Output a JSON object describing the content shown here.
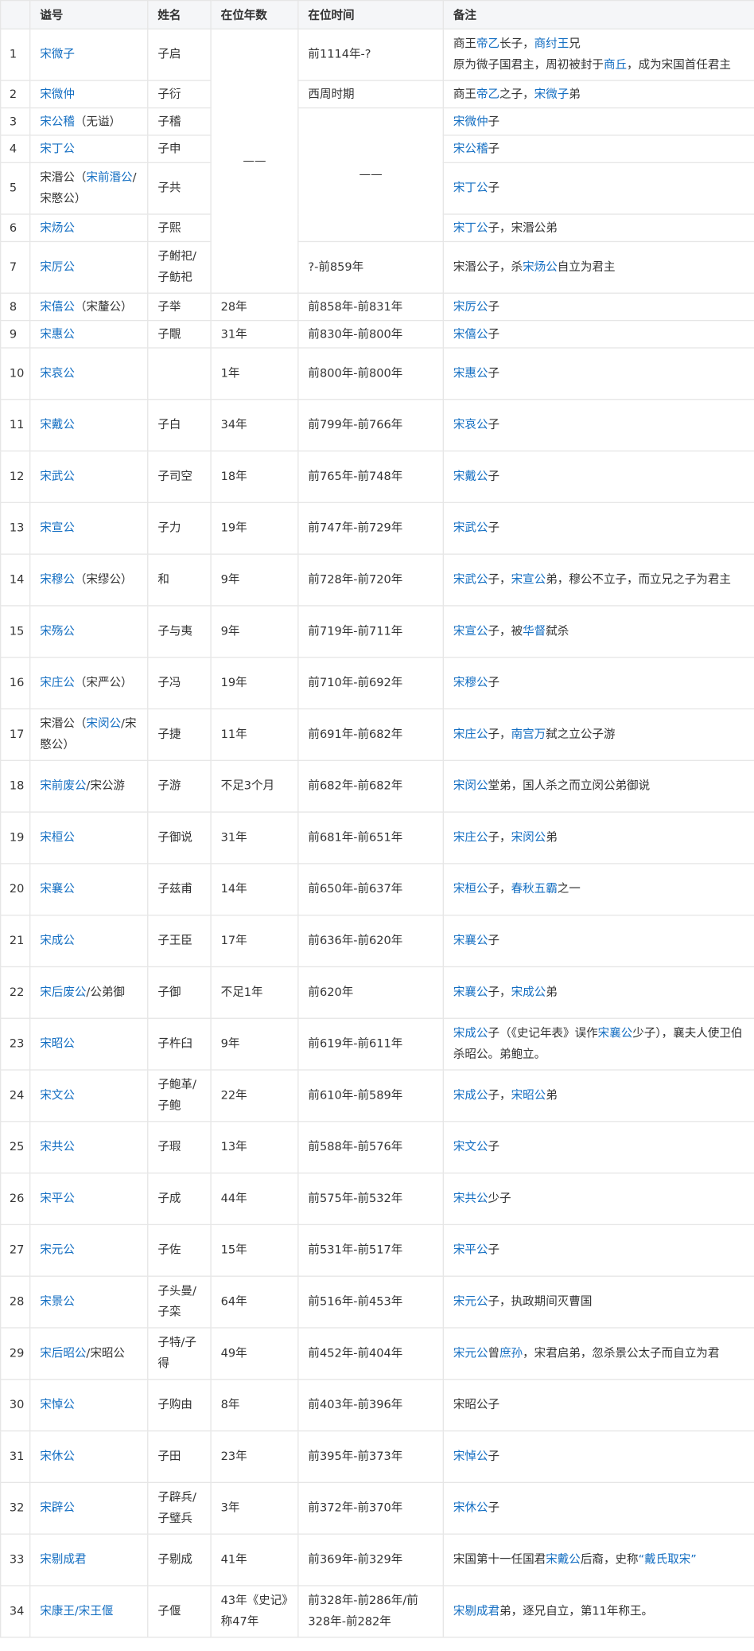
{
  "headers": {
    "index": "",
    "shi": "谥号",
    "name": "姓名",
    "years": "在位年数",
    "period": "在位时间",
    "note": "备注"
  },
  "dash": "——",
  "rows": [
    {
      "idx": "1",
      "shi": [
        {
          "t": "宋微子",
          "l": true
        }
      ],
      "name": "子启",
      "years": "",
      "period": "前1114年-?",
      "note": [
        {
          "t": "商王",
          "l": false
        },
        {
          "t": "帝乙",
          "l": true
        },
        {
          "t": "长子，",
          "l": false
        },
        {
          "t": "商纣王",
          "l": true
        },
        {
          "t": "兄",
          "l": false
        }
      ],
      "note2": [
        {
          "t": "原为微子国君主，周初被封于",
          "l": false
        },
        {
          "t": "商丘",
          "l": true
        },
        {
          "t": "，成为宋国首任君主",
          "l": false
        }
      ]
    },
    {
      "idx": "2",
      "shi": [
        {
          "t": "宋微仲",
          "l": true
        }
      ],
      "name": "子衍",
      "years": "",
      "period": "西周时期",
      "note": [
        {
          "t": "商王",
          "l": false
        },
        {
          "t": "帝乙",
          "l": true
        },
        {
          "t": "之子，",
          "l": false
        },
        {
          "t": "宋微子",
          "l": true
        },
        {
          "t": "弟",
          "l": false
        }
      ]
    },
    {
      "idx": "3",
      "shi": [
        {
          "t": "宋公稽",
          "l": true
        },
        {
          "t": "（无谥）",
          "l": false
        }
      ],
      "name": "子稽",
      "years": "",
      "period": "",
      "note": [
        {
          "t": "宋微仲",
          "l": true
        },
        {
          "t": "子",
          "l": false
        }
      ]
    },
    {
      "idx": "4",
      "shi": [
        {
          "t": "宋丁公",
          "l": true
        }
      ],
      "name": "子申",
      "years": "",
      "period": "",
      "note": [
        {
          "t": "宋公稽",
          "l": true
        },
        {
          "t": "子",
          "l": false
        }
      ]
    },
    {
      "idx": "5",
      "shi": [
        {
          "t": "宋湣公（",
          "l": false
        },
        {
          "t": "宋前湣公",
          "l": true
        },
        {
          "t": "/宋愍公）",
          "l": false
        }
      ],
      "name": "子共",
      "years": "",
      "period": "",
      "note": [
        {
          "t": "宋丁公",
          "l": true
        },
        {
          "t": "子",
          "l": false
        }
      ]
    },
    {
      "idx": "6",
      "shi": [
        {
          "t": "宋炀公",
          "l": true
        }
      ],
      "name": "子熙",
      "years": "",
      "period": "",
      "note": [
        {
          "t": "宋丁公",
          "l": true
        },
        {
          "t": "子，宋湣公弟",
          "l": false
        }
      ]
    },
    {
      "idx": "7",
      "shi": [
        {
          "t": "宋厉公",
          "l": true
        }
      ],
      "name": "子鲋祀/子鲂祀",
      "years": "",
      "period": "?-前859年",
      "note": [
        {
          "t": "宋湣公子，杀",
          "l": false
        },
        {
          "t": "宋炀公",
          "l": true
        },
        {
          "t": "自立为君主",
          "l": false
        }
      ]
    },
    {
      "idx": "8",
      "shi": [
        {
          "t": "宋僖公",
          "l": true
        },
        {
          "t": "（宋釐公）",
          "l": false
        }
      ],
      "name": "子举",
      "years": "28年",
      "period": "前858年-前831年",
      "note": [
        {
          "t": "宋厉公",
          "l": true
        },
        {
          "t": "子",
          "l": false
        }
      ]
    },
    {
      "idx": "9",
      "shi": [
        {
          "t": "宋惠公",
          "l": true
        }
      ],
      "name": "子覸",
      "years": "31年",
      "period": "前830年-前800年",
      "note": [
        {
          "t": "宋僖公",
          "l": true
        },
        {
          "t": "子",
          "l": false
        }
      ]
    },
    {
      "idx": "10",
      "shi": [
        {
          "t": "宋哀公",
          "l": true
        }
      ],
      "name": "",
      "years": "1年",
      "period": "前800年-前800年",
      "note": [
        {
          "t": "宋惠公",
          "l": true
        },
        {
          "t": "子",
          "l": false
        }
      ]
    },
    {
      "idx": "11",
      "shi": [
        {
          "t": "宋戴公",
          "l": true
        }
      ],
      "name": "子白",
      "years": "34年",
      "period": "前799年-前766年",
      "note": [
        {
          "t": "宋哀公",
          "l": true
        },
        {
          "t": "子",
          "l": false
        }
      ]
    },
    {
      "idx": "12",
      "shi": [
        {
          "t": "宋武公",
          "l": true
        }
      ],
      "name": "子司空",
      "years": "18年",
      "period": "前765年-前748年",
      "note": [
        {
          "t": "宋戴公",
          "l": true
        },
        {
          "t": "子",
          "l": false
        }
      ]
    },
    {
      "idx": "13",
      "shi": [
        {
          "t": "宋宣公",
          "l": true
        }
      ],
      "name": "子力",
      "years": "19年",
      "period": "前747年-前729年",
      "note": [
        {
          "t": "宋武公",
          "l": true
        },
        {
          "t": "子",
          "l": false
        }
      ]
    },
    {
      "idx": "14",
      "shi": [
        {
          "t": "宋穆公",
          "l": true
        },
        {
          "t": "（宋缪公）",
          "l": false
        }
      ],
      "name": "和",
      "years": "9年",
      "period": "前728年-前720年",
      "note": [
        {
          "t": "宋武公",
          "l": true
        },
        {
          "t": "子，",
          "l": false
        },
        {
          "t": "宋宣公",
          "l": true
        },
        {
          "t": "弟，穆公不立子，而立兄之子为君主",
          "l": false
        }
      ]
    },
    {
      "idx": "15",
      "shi": [
        {
          "t": "宋殇公",
          "l": true
        }
      ],
      "name": "子与夷",
      "years": "9年",
      "period": "前719年-前711年",
      "note": [
        {
          "t": "宋宣公",
          "l": true
        },
        {
          "t": "子，被",
          "l": false
        },
        {
          "t": "华督",
          "l": true
        },
        {
          "t": "弑杀",
          "l": false
        }
      ]
    },
    {
      "idx": "16",
      "shi": [
        {
          "t": "宋庄公",
          "l": true
        },
        {
          "t": "（宋严公）",
          "l": false
        }
      ],
      "name": "子冯",
      "years": "19年",
      "period": "前710年-前692年",
      "note": [
        {
          "t": "宋穆公",
          "l": true
        },
        {
          "t": "子",
          "l": false
        }
      ]
    },
    {
      "idx": "17",
      "shi": [
        {
          "t": "宋湣公（",
          "l": false
        },
        {
          "t": "宋闵公",
          "l": true
        },
        {
          "t": "/宋愍公）",
          "l": false
        }
      ],
      "name": "子捷",
      "years": "11年",
      "period": "前691年-前682年",
      "note": [
        {
          "t": "宋庄公",
          "l": true
        },
        {
          "t": "子，",
          "l": false
        },
        {
          "t": "南宫万",
          "l": true
        },
        {
          "t": "弑之立公子游",
          "l": false
        }
      ]
    },
    {
      "idx": "18",
      "shi": [
        {
          "t": "宋前废公",
          "l": true
        },
        {
          "t": "/宋公游",
          "l": false
        }
      ],
      "name": "子游",
      "years": "不足3个月",
      "period": "前682年-前682年",
      "note": [
        {
          "t": "宋闵公",
          "l": true
        },
        {
          "t": "堂弟，国人杀之而立闵公弟御说",
          "l": false
        }
      ]
    },
    {
      "idx": "19",
      "shi": [
        {
          "t": "宋桓公",
          "l": true
        }
      ],
      "name": "子御说",
      "years": "31年",
      "period": "前681年-前651年",
      "note": [
        {
          "t": "宋庄公",
          "l": true
        },
        {
          "t": "子，",
          "l": false
        },
        {
          "t": "宋闵公",
          "l": true
        },
        {
          "t": "弟",
          "l": false
        }
      ]
    },
    {
      "idx": "20",
      "shi": [
        {
          "t": "宋襄公",
          "l": true
        }
      ],
      "name": "子兹甫",
      "years": "14年",
      "period": "前650年-前637年",
      "note": [
        {
          "t": "宋桓公",
          "l": true
        },
        {
          "t": "子，",
          "l": false
        },
        {
          "t": "春秋五霸",
          "l": true
        },
        {
          "t": "之一",
          "l": false
        }
      ]
    },
    {
      "idx": "21",
      "shi": [
        {
          "t": "宋成公",
          "l": true
        }
      ],
      "name": "子王臣",
      "years": "17年",
      "period": "前636年-前620年",
      "note": [
        {
          "t": "宋襄公",
          "l": true
        },
        {
          "t": "子",
          "l": false
        }
      ]
    },
    {
      "idx": "22",
      "shi": [
        {
          "t": "宋后废公",
          "l": true
        },
        {
          "t": "/公弟御",
          "l": false
        }
      ],
      "name": "子御",
      "years": "不足1年",
      "period": "前620年",
      "note": [
        {
          "t": "宋襄公",
          "l": true
        },
        {
          "t": "子，",
          "l": false
        },
        {
          "t": "宋成公",
          "l": true
        },
        {
          "t": "弟",
          "l": false
        }
      ]
    },
    {
      "idx": "23",
      "shi": [
        {
          "t": "宋昭公",
          "l": true
        }
      ],
      "name": "子杵臼",
      "years": "9年",
      "period": "前619年-前611年",
      "note": [
        {
          "t": "宋成公",
          "l": true
        },
        {
          "t": "子（《史记年表》误作",
          "l": false
        },
        {
          "t": "宋襄公",
          "l": true
        },
        {
          "t": "少子），襄夫人使卫伯杀昭公。弟鲍立。",
          "l": false
        }
      ]
    },
    {
      "idx": "24",
      "shi": [
        {
          "t": "宋文公",
          "l": true
        }
      ],
      "name": "子鲍革/子鲍",
      "years": "22年",
      "period": "前610年-前589年",
      "note": [
        {
          "t": "宋成公",
          "l": true
        },
        {
          "t": "子，",
          "l": false
        },
        {
          "t": "宋昭公",
          "l": true
        },
        {
          "t": "弟",
          "l": false
        }
      ]
    },
    {
      "idx": "25",
      "shi": [
        {
          "t": "宋共公",
          "l": true
        }
      ],
      "name": "子瑕",
      "years": "13年",
      "period": "前588年-前576年",
      "note": [
        {
          "t": "宋文公",
          "l": true
        },
        {
          "t": "子",
          "l": false
        }
      ]
    },
    {
      "idx": "26",
      "shi": [
        {
          "t": "宋平公",
          "l": true
        }
      ],
      "name": "子成",
      "years": "44年",
      "period": "前575年-前532年",
      "note": [
        {
          "t": "宋共公",
          "l": true
        },
        {
          "t": "少子",
          "l": false
        }
      ]
    },
    {
      "idx": "27",
      "shi": [
        {
          "t": "宋元公",
          "l": true
        }
      ],
      "name": "子佐",
      "years": "15年",
      "period": "前531年-前517年",
      "note": [
        {
          "t": "宋平公",
          "l": true
        },
        {
          "t": "子",
          "l": false
        }
      ]
    },
    {
      "idx": "28",
      "shi": [
        {
          "t": "宋景公",
          "l": true
        }
      ],
      "name": "子头曼/子栾",
      "years": "64年",
      "period": "前516年-前453年",
      "note": [
        {
          "t": "宋元公",
          "l": true
        },
        {
          "t": "子，执政期间灭曹国",
          "l": false
        }
      ]
    },
    {
      "idx": "29",
      "shi": [
        {
          "t": "宋后昭公",
          "l": true
        },
        {
          "t": "/宋昭公",
          "l": false
        }
      ],
      "name": "子特/子得",
      "years": "49年",
      "period": "前452年-前404年",
      "note": [
        {
          "t": "宋元公",
          "l": true
        },
        {
          "t": "曾",
          "l": false
        },
        {
          "t": "庶孙",
          "l": true
        },
        {
          "t": "，宋君启弟，忽杀景公太子而自立为君",
          "l": false
        }
      ]
    },
    {
      "idx": "30",
      "shi": [
        {
          "t": "宋悼公",
          "l": true
        }
      ],
      "name": "子购由",
      "years": "8年",
      "period": "前403年-前396年",
      "note": [
        {
          "t": "宋昭公子",
          "l": false
        }
      ]
    },
    {
      "idx": "31",
      "shi": [
        {
          "t": "宋休公",
          "l": true
        }
      ],
      "name": "子田",
      "years": "23年",
      "period": "前395年-前373年",
      "note": [
        {
          "t": "宋悼公",
          "l": true
        },
        {
          "t": "子",
          "l": false
        }
      ]
    },
    {
      "idx": "32",
      "shi": [
        {
          "t": "宋辟公",
          "l": true
        }
      ],
      "name": "子辟兵/子璧兵",
      "years": "3年",
      "period": "前372年-前370年",
      "note": [
        {
          "t": "宋休公",
          "l": true
        },
        {
          "t": "子",
          "l": false
        }
      ]
    },
    {
      "idx": "33",
      "shi": [
        {
          "t": "宋剔成君",
          "l": true
        }
      ],
      "name": "子剔成",
      "years": "41年",
      "period": "前369年-前329年",
      "note": [
        {
          "t": "宋国第十一任国君",
          "l": false
        },
        {
          "t": "宋戴公",
          "l": true
        },
        {
          "t": "后裔，史称",
          "l": false
        },
        {
          "t": "“戴氏取宋”",
          "l": true
        }
      ]
    },
    {
      "idx": "34",
      "shi": [
        {
          "t": "宋康王/宋王偃",
          "l": true
        }
      ],
      "name": "子偃",
      "years": "43年《史记》称47年",
      "period": "前328年-前286年/前328年-前282年",
      "note": [
        {
          "t": "宋剔成君",
          "l": true
        },
        {
          "t": "弟，逐兄自立，第11年称王。",
          "l": false
        }
      ]
    }
  ]
}
